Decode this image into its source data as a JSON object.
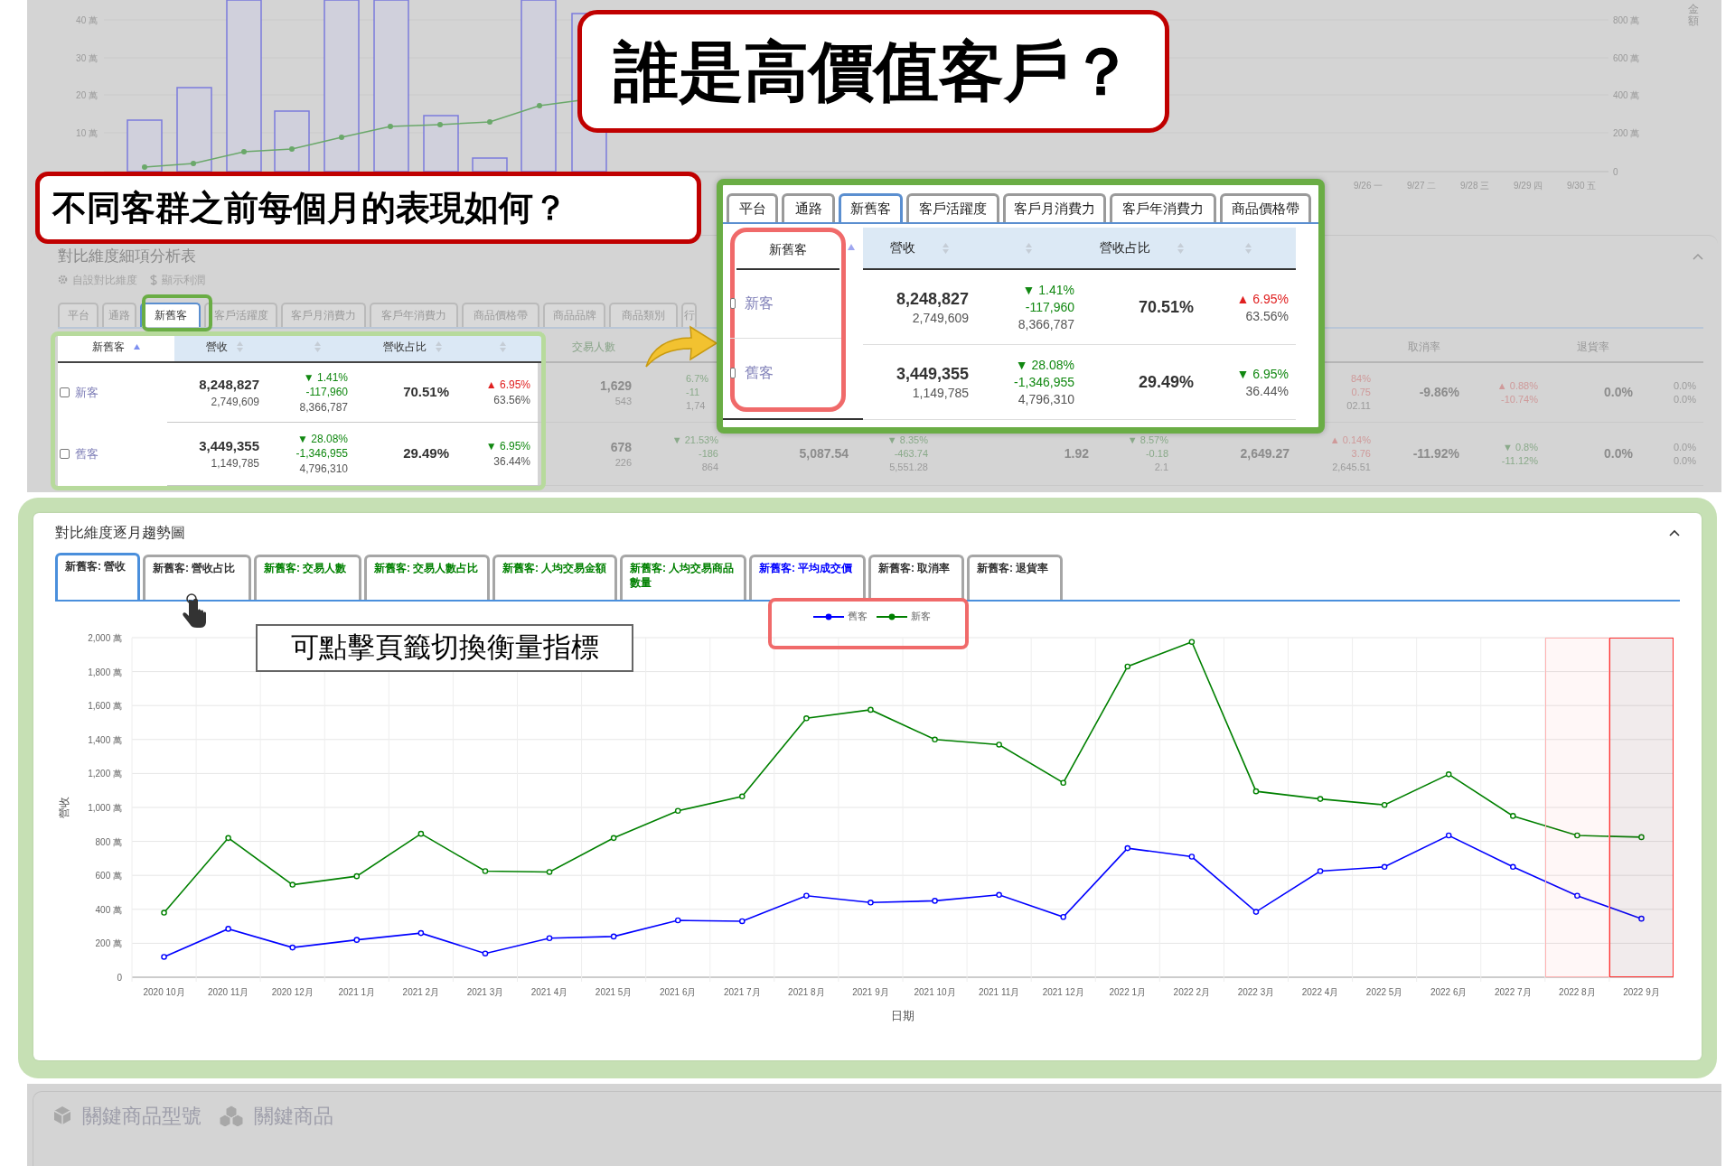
{
  "annotations": {
    "headline": "誰是高價值客戶？",
    "question": "不同客群之前每個月的表現如何？",
    "tab_hint": "可點擊頁籤切換衡量指標"
  },
  "background_chart": {
    "left_ticks": [
      "40 萬",
      "30 萬",
      "20 萬",
      "10 萬"
    ],
    "right_ticks": [
      "800 萬",
      "600 萬",
      "400 萬",
      "200 萬",
      "0"
    ],
    "right_axis_title": "金額",
    "dates": [
      "9/26 一",
      "9/27 二",
      "9/28 三",
      "9/29 四",
      "9/30 五"
    ]
  },
  "detail_table": {
    "title": "對比維度細項分析表",
    "links": [
      "自設對比維度",
      "顯示利潤"
    ],
    "tabs": [
      {
        "label": "平台",
        "selected": false
      },
      {
        "label": "通路",
        "selected": false
      },
      {
        "label": "新舊客",
        "selected": true
      },
      {
        "label": "客戶活躍度",
        "selected": false
      },
      {
        "label": "客戶月消費力",
        "selected": false
      },
      {
        "label": "客戶年消費力",
        "selected": false
      },
      {
        "label": "商品價格帶",
        "selected": false
      },
      {
        "label": "商品品牌",
        "selected": false
      },
      {
        "label": "商品類別",
        "selected": false
      },
      {
        "label": "行",
        "selected": false
      }
    ],
    "header": {
      "name": "新舊客",
      "revenue": "營收",
      "share": "營收占比",
      "buyers": "交易人數",
      "cancel_rate": "取消率",
      "return_rate": "退貨率"
    },
    "rows": [
      {
        "name": "新客",
        "checked": false,
        "cells": [
          {
            "kind": "stack",
            "lines": [
              {
                "text": "8,248,827",
                "kind": "main"
              },
              {
                "text": "2,749,609",
                "kind": "sub"
              }
            ]
          },
          {
            "kind": "stack",
            "lines": [
              {
                "text": "▼ 1.41%",
                "kind": "change",
                "color": "#118811"
              },
              {
                "text": "-117,960",
                "kind": "change",
                "color": "#118811"
              },
              {
                "text": "8,366,787",
                "kind": "sub"
              }
            ]
          },
          {
            "kind": "stack",
            "lines": [
              {
                "text": "70.51%",
                "kind": "main"
              }
            ]
          },
          {
            "kind": "stack",
            "lines": [
              {
                "text": "▲ 6.95%",
                "kind": "change",
                "color": "#e02020"
              },
              {
                "text": "63.56%",
                "kind": "sub"
              }
            ]
          },
          {
            "kind": "stack",
            "lines": [
              {
                "text": "1,629",
                "kind": "main"
              },
              {
                "text": "543",
                "kind": "sub"
              }
            ]
          },
          {
            "kind": "clipped",
            "lines": [
              {
                "text": "6.7%",
                "kind": "change",
                "color": "#8aaa8a"
              },
              {
                "text": "-11",
                "kind": "change",
                "color": "#8aaa8a"
              },
              {
                "text": "1,74",
                "kind": "sub"
              }
            ]
          },
          {
            "kind": "covered"
          },
          {
            "kind": "covered"
          },
          {
            "kind": "covered"
          },
          {
            "kind": "covered"
          },
          {
            "kind": "covered"
          },
          {
            "kind": "stack",
            "lines": [
              {
                "text": "84%",
                "kind": "change",
                "color": "#cf9a9a"
              },
              {
                "text": "0.75",
                "kind": "change",
                "color": "#cf9a9a"
              },
              {
                "text": "02.11",
                "kind": "sub"
              }
            ]
          },
          {
            "kind": "stack",
            "lines": [
              {
                "text": "-9.86%",
                "kind": "main"
              }
            ]
          },
          {
            "kind": "stack",
            "lines": [
              {
                "text": "▲ 0.88%",
                "kind": "change",
                "color": "#cf9a9a"
              },
              {
                "text": "-10.74%",
                "kind": "change",
                "color": "#cf9a9a"
              }
            ]
          },
          {
            "kind": "stack",
            "lines": [
              {
                "text": "0.0%",
                "kind": "main"
              }
            ]
          },
          {
            "kind": "stack",
            "lines": [
              {
                "text": "0.0%",
                "kind": "sub"
              },
              {
                "text": "0.0%",
                "kind": "sub"
              }
            ]
          }
        ]
      },
      {
        "name": "舊客",
        "checked": false,
        "cells": [
          {
            "kind": "stack",
            "lines": [
              {
                "text": "3,449,355",
                "kind": "main"
              },
              {
                "text": "1,149,785",
                "kind": "sub"
              }
            ]
          },
          {
            "kind": "stack",
            "lines": [
              {
                "text": "▼ 28.08%",
                "kind": "change",
                "color": "#118811"
              },
              {
                "text": "-1,346,955",
                "kind": "change",
                "color": "#118811"
              },
              {
                "text": "4,796,310",
                "kind": "sub"
              }
            ]
          },
          {
            "kind": "stack",
            "lines": [
              {
                "text": "29.49%",
                "kind": "main"
              }
            ]
          },
          {
            "kind": "stack",
            "lines": [
              {
                "text": "▼ 6.95%",
                "kind": "change",
                "color": "#118811"
              },
              {
                "text": "36.44%",
                "kind": "sub"
              }
            ]
          },
          {
            "kind": "stack",
            "lines": [
              {
                "text": "678",
                "kind": "main"
              },
              {
                "text": "226",
                "kind": "sub"
              }
            ]
          },
          {
            "kind": "stack",
            "lines": [
              {
                "text": "▼ 21.53%",
                "kind": "change",
                "color": "#8aaa8a"
              },
              {
                "text": "-186",
                "kind": "change",
                "color": "#8aaa8a"
              },
              {
                "text": "864",
                "kind": "sub"
              }
            ]
          },
          {
            "kind": "stack",
            "lines": [
              {
                "text": "5,087.54",
                "kind": "main"
              }
            ]
          },
          {
            "kind": "stack",
            "lines": [
              {
                "text": "▼ 8.35%",
                "kind": "change",
                "color": "#8aaa8a"
              },
              {
                "text": "-463.74",
                "kind": "change",
                "color": "#8aaa8a"
              },
              {
                "text": "5,551.28",
                "kind": "sub"
              }
            ]
          },
          {
            "kind": "stack",
            "lines": [
              {
                "text": "1.92",
                "kind": "main"
              }
            ]
          },
          {
            "kind": "stack",
            "lines": [
              {
                "text": "▼ 8.57%",
                "kind": "change",
                "color": "#8aaa8a"
              },
              {
                "text": "-0.18",
                "kind": "change",
                "color": "#8aaa8a"
              },
              {
                "text": "2.1",
                "kind": "sub"
              }
            ]
          },
          {
            "kind": "stack",
            "lines": [
              {
                "text": "2,649.27",
                "kind": "main"
              }
            ]
          },
          {
            "kind": "stack",
            "lines": [
              {
                "text": "▲ 0.14%",
                "kind": "change",
                "color": "#cf9a9a"
              },
              {
                "text": "3.76",
                "kind": "change",
                "color": "#cf9a9a"
              },
              {
                "text": "2,645.51",
                "kind": "sub"
              }
            ]
          },
          {
            "kind": "stack",
            "lines": [
              {
                "text": "-11.92%",
                "kind": "main"
              }
            ]
          },
          {
            "kind": "stack",
            "lines": [
              {
                "text": "▼ 0.8%",
                "kind": "change",
                "color": "#8aaa8a"
              },
              {
                "text": "-11.12%",
                "kind": "change",
                "color": "#8aaa8a"
              }
            ]
          },
          {
            "kind": "stack",
            "lines": [
              {
                "text": "0.0%",
                "kind": "main"
              }
            ]
          },
          {
            "kind": "stack",
            "lines": [
              {
                "text": "0.0%",
                "kind": "sub"
              },
              {
                "text": "0.0%",
                "kind": "sub"
              }
            ]
          }
        ]
      }
    ]
  },
  "zoom_inset": {
    "tabs": [
      {
        "label": "平台",
        "selected": false
      },
      {
        "label": "通路",
        "selected": false
      },
      {
        "label": "新舊客",
        "selected": true
      },
      {
        "label": "客戶活躍度",
        "selected": false
      },
      {
        "label": "客戶月消費力",
        "selected": false
      },
      {
        "label": "客戶年消費力",
        "selected": false
      },
      {
        "label": "商品價格帶",
        "selected": false
      }
    ],
    "header": {
      "name": "新舊客",
      "revenue": "營收",
      "share": "營收占比"
    },
    "rows": [
      {
        "name": "新客",
        "checked": false,
        "cells": [
          {
            "kind": "stack",
            "lines": [
              {
                "text": "8,248,827",
                "kind": "main"
              },
              {
                "text": "2,749,609",
                "kind": "sub"
              }
            ]
          },
          {
            "kind": "stack",
            "lines": [
              {
                "text": "▼ 1.41%",
                "kind": "change",
                "color": "#118811"
              },
              {
                "text": "-117,960",
                "kind": "change",
                "color": "#118811"
              },
              {
                "text": "8,366,787",
                "kind": "sub"
              }
            ]
          },
          {
            "kind": "stack",
            "lines": [
              {
                "text": "70.51%",
                "kind": "main"
              }
            ]
          },
          {
            "kind": "stack",
            "lines": [
              {
                "text": "▲ 6.95%",
                "kind": "change",
                "color": "#e02020"
              },
              {
                "text": "63.56%",
                "kind": "sub"
              }
            ]
          }
        ]
      },
      {
        "name": "舊客",
        "checked": false,
        "cells": [
          {
            "kind": "stack",
            "lines": [
              {
                "text": "3,449,355",
                "kind": "main"
              },
              {
                "text": "1,149,785",
                "kind": "sub"
              }
            ]
          },
          {
            "kind": "stack",
            "lines": [
              {
                "text": "▼ 28.08%",
                "kind": "change",
                "color": "#118811"
              },
              {
                "text": "-1,346,955",
                "kind": "change",
                "color": "#118811"
              },
              {
                "text": "4,796,310",
                "kind": "sub"
              }
            ]
          },
          {
            "kind": "stack",
            "lines": [
              {
                "text": "29.49%",
                "kind": "main"
              }
            ]
          },
          {
            "kind": "stack",
            "lines": [
              {
                "text": "▼ 6.95%",
                "kind": "change",
                "color": "#118811"
              },
              {
                "text": "36.44%",
                "kind": "sub"
              }
            ]
          }
        ]
      }
    ]
  },
  "trend_card": {
    "title": "對比維度逐月趨勢圖",
    "tabs": [
      {
        "label": "新舊客: 營收",
        "selected": true,
        "color": "#333333"
      },
      {
        "label": "新舊客: 營收占比",
        "selected": false,
        "color": "#333333"
      },
      {
        "label": "新舊客: 交易人數",
        "selected": false,
        "color": "#008000"
      },
      {
        "label": "新舊客: 交易人數占比",
        "selected": false,
        "color": "#008000"
      },
      {
        "label": "新舊客: 人均交易金額",
        "selected": false,
        "color": "#008000"
      },
      {
        "label": "新舊客: 人均交易商品數量",
        "selected": false,
        "color": "#008000"
      },
      {
        "label": "新舊客: 平均成交價",
        "selected": false,
        "color": "#0000ff"
      },
      {
        "label": "新舊客: 取消率",
        "selected": false,
        "color": "#333333"
      },
      {
        "label": "新舊客: 退貨率",
        "selected": false,
        "color": "#333333"
      }
    ],
    "chart_data": {
      "type": "line",
      "xlabel": "日期",
      "ylabel": "營收",
      "grid": true,
      "categories": [
        "2020 10月",
        "2020 11月",
        "2020 12月",
        "2021 1月",
        "2021 2月",
        "2021 3月",
        "2021 4月",
        "2021 5月",
        "2021 6月",
        "2021 7月",
        "2021 8月",
        "2021 9月",
        "2021 10月",
        "2021 11月",
        "2021 12月",
        "2022 1月",
        "2022 2月",
        "2022 3月",
        "2022 4月",
        "2022 5月",
        "2022 6月",
        "2022 7月",
        "2022 8月",
        "2022 9月"
      ],
      "series": [
        {
          "name": "舊客",
          "color": "#0000ff",
          "marker": "circle",
          "values": [
            120,
            285,
            175,
            220,
            260,
            140,
            230,
            240,
            335,
            330,
            480,
            440,
            450,
            485,
            355,
            760,
            710,
            385,
            625,
            650,
            835,
            650,
            480,
            345
          ]
        },
        {
          "name": "新客",
          "color": "#008000",
          "marker": "circle",
          "values": [
            380,
            820,
            545,
            595,
            845,
            625,
            620,
            820,
            980,
            1065,
            1525,
            1575,
            1400,
            1370,
            1145,
            1830,
            1975,
            1095,
            1050,
            1015,
            1195,
            950,
            835,
            825
          ]
        }
      ],
      "ylim": [
        0,
        2000
      ],
      "yticks": [
        {
          "value": 0,
          "label": "0"
        },
        {
          "value": 200,
          "label": "200 萬"
        },
        {
          "value": 400,
          "label": "400 萬"
        },
        {
          "value": 600,
          "label": "600 萬"
        },
        {
          "value": 800,
          "label": "800 萬"
        },
        {
          "value": 1000,
          "label": "1,000 萬"
        },
        {
          "value": 1200,
          "label": "1,200 萬"
        },
        {
          "value": 1400,
          "label": "1,400 萬"
        },
        {
          "value": 1600,
          "label": "1,600 萬"
        },
        {
          "value": 1800,
          "label": "1,800 萬"
        },
        {
          "value": 2000,
          "label": "2,000 萬"
        }
      ]
    }
  },
  "footer_tabs": [
    "關鍵商品型號",
    "關鍵商品"
  ]
}
